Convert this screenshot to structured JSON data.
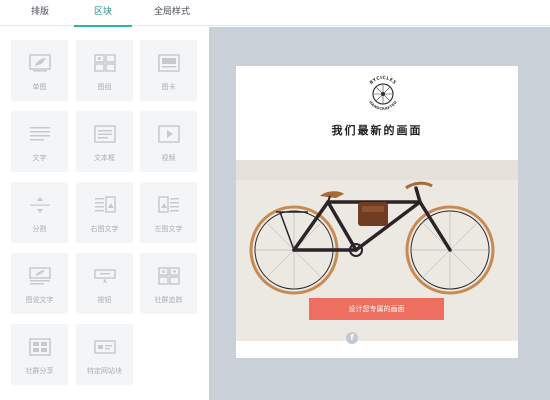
{
  "tabs": [
    {
      "label": "排版",
      "active": false
    },
    {
      "label": "区块",
      "active": true
    },
    {
      "label": "全局样式",
      "active": false
    }
  ],
  "blocks": [
    {
      "label": "单图",
      "icon": "single-image-icon"
    },
    {
      "label": "图组",
      "icon": "image-group-icon"
    },
    {
      "label": "图卡",
      "icon": "image-card-icon"
    },
    {
      "label": "文字",
      "icon": "text-icon"
    },
    {
      "label": "文本框",
      "icon": "text-box-icon"
    },
    {
      "label": "视频",
      "icon": "video-icon"
    },
    {
      "label": "分割",
      "icon": "divider-icon"
    },
    {
      "label": "右图文字",
      "icon": "right-image-text-icon"
    },
    {
      "label": "左图文字",
      "icon": "left-image-text-icon"
    },
    {
      "label": "图说文字",
      "icon": "caption-text-icon"
    },
    {
      "label": "按钮",
      "icon": "button-icon"
    },
    {
      "label": "社群追踪",
      "icon": "social-follow-icon"
    },
    {
      "label": "社群分享",
      "icon": "social-share-icon"
    },
    {
      "label": "特定网站块",
      "icon": "website-block-icon"
    }
  ],
  "email": {
    "logo_top": "BYCICLES",
    "logo_bottom": "HANDCRAFTED",
    "headline": "我们最新的画面",
    "cta_label": "设计您专属的画面",
    "social_icon": "facebook-icon"
  },
  "colors": {
    "accent": "#2bb5a5",
    "cta": "#ee6f5f",
    "preview_bg": "#c9d0d8",
    "tile_bg": "#f4f5f6"
  }
}
